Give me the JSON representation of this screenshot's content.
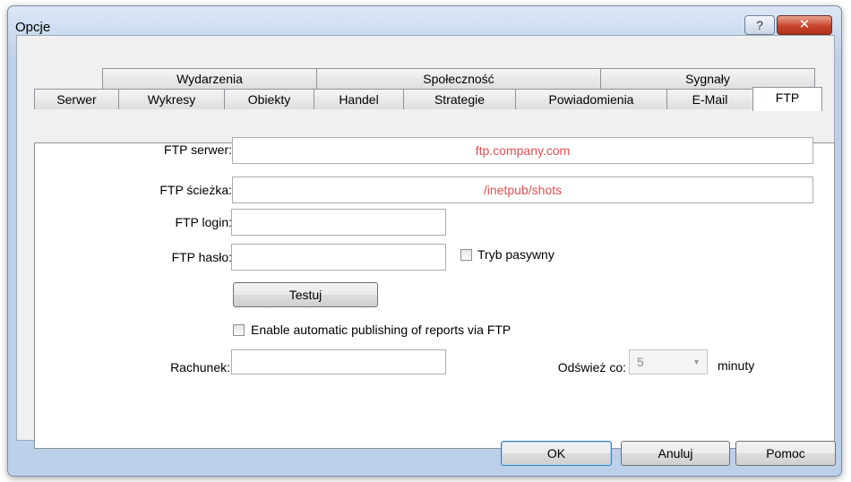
{
  "window": {
    "title": "Opcje",
    "help_glyph": "?",
    "close_glyph": "✕"
  },
  "tabs_row1": [
    "Wydarzenia",
    "Społeczność",
    "Sygnały"
  ],
  "tabs_row2": [
    "Serwer",
    "Wykresy",
    "Obiekty",
    "Handel",
    "Strategie",
    "Powiadomienia",
    "E-Mail",
    "FTP"
  ],
  "active_tab": "FTP",
  "form": {
    "ftp_server_label": "FTP serwer:",
    "ftp_server_value": "ftp.company.com",
    "ftp_path_label": "FTP ścieżka:",
    "ftp_path_value": "/inetpub/shots",
    "ftp_login_label": "FTP login:",
    "ftp_login_value": "",
    "ftp_password_label": "FTP hasło:",
    "ftp_password_value": "",
    "passive_mode_label": "Tryb pasywny",
    "test_button_label": "Testuj",
    "auto_publish_label": "Enable automatic publishing of reports via FTP",
    "account_label": "Rachunek:",
    "account_value": "",
    "refresh_label": "Odśwież co:",
    "refresh_value": "5",
    "refresh_unit": "minuty"
  },
  "buttons": {
    "ok_label": "OK",
    "cancel_label": "Anuluj",
    "help_label": "Pomoc"
  }
}
